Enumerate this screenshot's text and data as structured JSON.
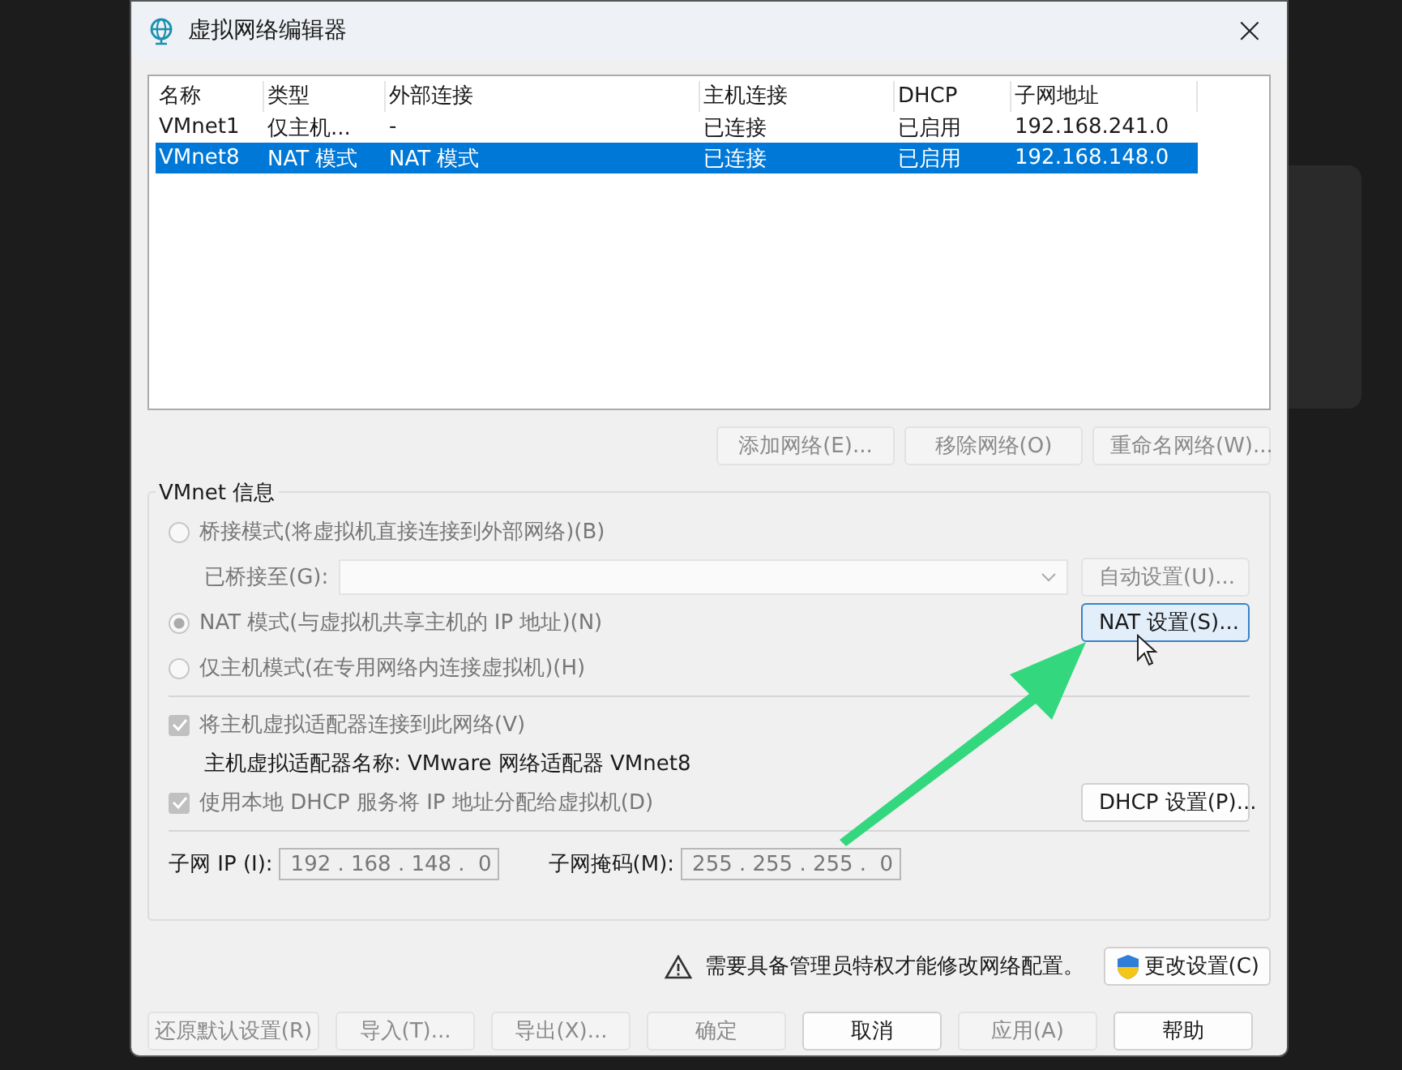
{
  "window": {
    "title": "虚拟网络编辑器",
    "close": "×"
  },
  "table": {
    "columns": [
      "名称",
      "类型",
      "外部连接",
      "主机连接",
      "DHCP",
      "子网地址"
    ],
    "rows": [
      {
        "cells": [
          "VMnet1",
          "仅主机...",
          "-",
          "已连接",
          "已启用",
          "192.168.241.0"
        ],
        "selected": false
      },
      {
        "cells": [
          "VMnet8",
          "NAT 模式",
          "NAT 模式",
          "已连接",
          "已启用",
          "192.168.148.0"
        ],
        "selected": true
      }
    ]
  },
  "list_buttons": [
    {
      "label": "添加网络(E)...",
      "disabled": true
    },
    {
      "label": "移除网络(O)",
      "disabled": true
    },
    {
      "label": "重命名网络(W)...",
      "disabled": true
    }
  ],
  "vmnet_info": {
    "title": "VMnet 信息",
    "modes": [
      {
        "kind": "bridged",
        "label": "桥接模式(将虚拟机直接连接到外部网络)(B)",
        "selected": false
      },
      {
        "kind": "nat",
        "label": "NAT 模式(与虚拟机共享主机的 IP 地址)(N)",
        "selected": true
      },
      {
        "kind": "hostonly",
        "label": "仅主机模式(在专用网络内连接虚拟机)(H)",
        "selected": false
      }
    ],
    "bridged_to": {
      "label": "已桥接至(G):",
      "button": "自动设置(U)..."
    },
    "nat_button": {
      "label": "NAT 设置(S)...",
      "focused": true
    },
    "connect_adapter": {
      "label": "将主机虚拟适配器连接到此网络(V)",
      "checked": true
    },
    "adapter_name": "主机虚拟适配器名称: VMware 网络适配器 VMnet8",
    "use_dhcp": {
      "label": "使用本地 DHCP 服务将 IP 地址分配给虚拟机(D)",
      "checked": true
    },
    "dhcp_button": "DHCP 设置(P)...",
    "subnet_ip": {
      "label": "子网 IP (I):",
      "value": "192 . 168 . 148 .  0"
    },
    "subnet_mask": {
      "label": "子网掩码(M):",
      "value": "255 . 255 . 255 .  0"
    }
  },
  "warning": {
    "text": "需要具备管理员特权才能修改网络配置。",
    "button": "更改设置(C)"
  },
  "footer_buttons": [
    {
      "label": "还原默认设置(R)",
      "disabled": true
    },
    {
      "label": "导入(T)...",
      "disabled": true
    },
    {
      "label": "导出(X)...",
      "disabled": true
    },
    {
      "label": "确定",
      "disabled": true
    },
    {
      "label": "取消",
      "disabled": false
    },
    {
      "label": "应用(A)",
      "disabled": true
    },
    {
      "label": "帮助",
      "disabled": false
    }
  ]
}
